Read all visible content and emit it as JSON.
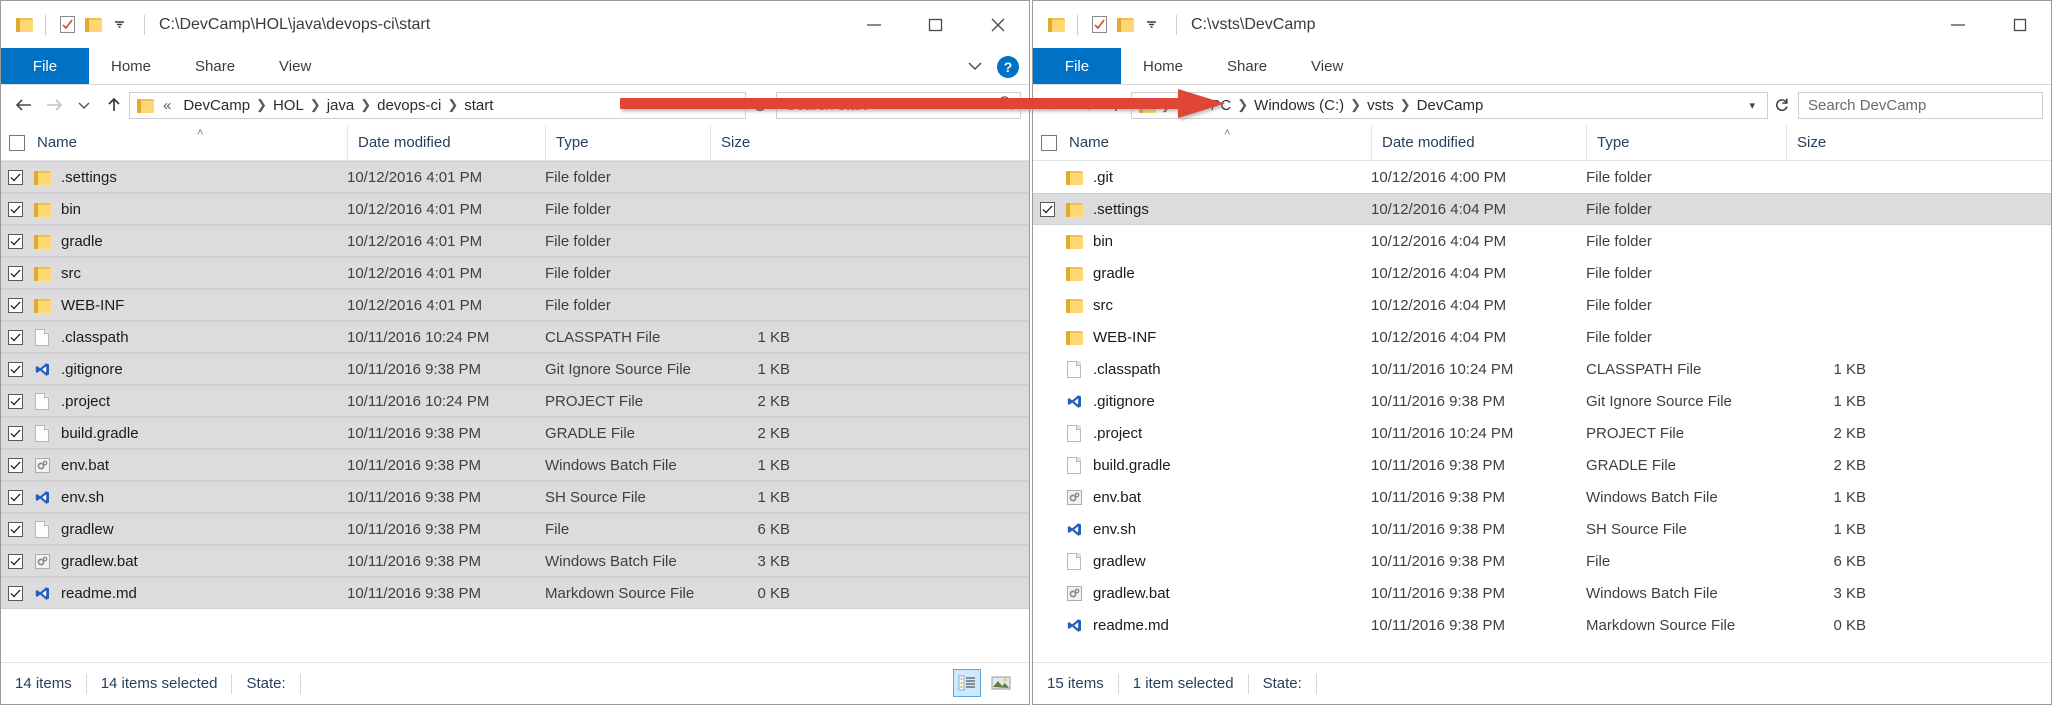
{
  "left_window": {
    "title_path": "C:\\DevCamp\\HOL\\java\\devops-ci\\start",
    "quick_access": {
      "folder_icon": "folder-icon",
      "properties_icon": "properties-icon",
      "new-folder_icon": "new-folder-icon",
      "dropdown_icon": "chevron-down-icon"
    },
    "window_controls": {
      "minimize": "minimize-icon",
      "maximize": "maximize-icon",
      "close": "close-icon"
    },
    "ribbon": {
      "tabs": [
        "File",
        "Home",
        "Share",
        "View"
      ],
      "expand_icon": "chevron-down-icon",
      "help_label": "?"
    },
    "address": {
      "back_icon": "back-arrow-icon",
      "forward_icon": "forward-arrow-icon",
      "recent_icon": "chevron-down-icon",
      "up_icon": "up-arrow-icon",
      "prefix": "«",
      "crumbs": [
        "DevCamp",
        "HOL",
        "java",
        "devops-ci",
        "start"
      ],
      "dropdown_icon": "chevron-down-icon",
      "refresh_icon": "refresh-icon",
      "search_placeholder": "Search start",
      "search_icon": "search-icon"
    },
    "columns": [
      "Name",
      "Date modified",
      "Type",
      "Size"
    ],
    "sort_indicator": "˄",
    "rows": [
      {
        "checked": true,
        "selected": true,
        "icon": "folder-icon",
        "name": ".settings",
        "date": "10/12/2016 4:01 PM",
        "type": "File folder",
        "size": ""
      },
      {
        "checked": true,
        "selected": true,
        "icon": "folder-icon",
        "name": "bin",
        "date": "10/12/2016 4:01 PM",
        "type": "File folder",
        "size": ""
      },
      {
        "checked": true,
        "selected": true,
        "icon": "folder-icon",
        "name": "gradle",
        "date": "10/12/2016 4:01 PM",
        "type": "File folder",
        "size": ""
      },
      {
        "checked": true,
        "selected": true,
        "icon": "folder-icon",
        "name": "src",
        "date": "10/12/2016 4:01 PM",
        "type": "File folder",
        "size": ""
      },
      {
        "checked": true,
        "selected": true,
        "icon": "folder-icon",
        "name": "WEB-INF",
        "date": "10/12/2016 4:01 PM",
        "type": "File folder",
        "size": ""
      },
      {
        "checked": true,
        "selected": true,
        "icon": "document-icon",
        "name": ".classpath",
        "date": "10/11/2016 10:24 PM",
        "type": "CLASSPATH File",
        "size": "1 KB"
      },
      {
        "checked": true,
        "selected": true,
        "icon": "visualstudio-icon",
        "name": ".gitignore",
        "date": "10/11/2016 9:38 PM",
        "type": "Git Ignore Source File",
        "size": "1 KB"
      },
      {
        "checked": true,
        "selected": true,
        "icon": "document-icon",
        "name": ".project",
        "date": "10/11/2016 10:24 PM",
        "type": "PROJECT File",
        "size": "2 KB"
      },
      {
        "checked": true,
        "selected": true,
        "icon": "document-icon",
        "name": "build.gradle",
        "date": "10/11/2016 9:38 PM",
        "type": "GRADLE File",
        "size": "2 KB"
      },
      {
        "checked": true,
        "selected": true,
        "icon": "batch-icon",
        "name": "env.bat",
        "date": "10/11/2016 9:38 PM",
        "type": "Windows Batch File",
        "size": "1 KB"
      },
      {
        "checked": true,
        "selected": true,
        "icon": "visualstudio-icon",
        "name": "env.sh",
        "date": "10/11/2016 9:38 PM",
        "type": "SH Source File",
        "size": "1 KB"
      },
      {
        "checked": true,
        "selected": true,
        "icon": "document-icon",
        "name": "gradlew",
        "date": "10/11/2016 9:38 PM",
        "type": "File",
        "size": "6 KB"
      },
      {
        "checked": true,
        "selected": true,
        "icon": "batch-icon",
        "name": "gradlew.bat",
        "date": "10/11/2016 9:38 PM",
        "type": "Windows Batch File",
        "size": "3 KB"
      },
      {
        "checked": true,
        "selected": true,
        "icon": "visualstudio-icon",
        "name": "readme.md",
        "date": "10/11/2016 9:38 PM",
        "type": "Markdown Source File",
        "size": "0 KB"
      }
    ],
    "status": {
      "count": "14 items",
      "selected": "14 items selected",
      "state_label": "State:",
      "details_view_icon": "details-view-icon",
      "large-icons_view_icon": "large-icons-view-icon"
    }
  },
  "right_window": {
    "title_path": "C:\\vsts\\DevCamp",
    "quick_access": {
      "folder_icon": "folder-icon",
      "properties_icon": "properties-icon",
      "new-folder_icon": "new-folder-icon",
      "dropdown_icon": "chevron-down-icon"
    },
    "window_controls": {
      "minimize": "minimize-icon",
      "maximize": "maximize-icon"
    },
    "ribbon": {
      "tabs": [
        "File",
        "Home",
        "Share",
        "View"
      ]
    },
    "address": {
      "back_icon": "back-arrow-icon",
      "forward_icon": "forward-arrow-icon",
      "up_icon": "up-arrow-icon",
      "crumbs": [
        "This PC",
        "Windows (C:)",
        "vsts",
        "DevCamp"
      ],
      "dropdown_icon": "chevron-down-icon",
      "refresh_icon": "refresh-icon",
      "search_placeholder": "Search DevCamp",
      "search_icon": "search-icon"
    },
    "columns": [
      "Name",
      "Date modified",
      "Type",
      "Size"
    ],
    "sort_indicator": "˄",
    "rows": [
      {
        "checked": false,
        "selected": false,
        "icon": "folder-icon",
        "name": ".git",
        "date": "10/12/2016 4:00 PM",
        "type": "File folder",
        "size": ""
      },
      {
        "checked": true,
        "selected": true,
        "icon": "folder-icon",
        "name": ".settings",
        "date": "10/12/2016 4:04 PM",
        "type": "File folder",
        "size": ""
      },
      {
        "checked": false,
        "selected": false,
        "icon": "folder-icon",
        "name": "bin",
        "date": "10/12/2016 4:04 PM",
        "type": "File folder",
        "size": ""
      },
      {
        "checked": false,
        "selected": false,
        "icon": "folder-icon",
        "name": "gradle",
        "date": "10/12/2016 4:04 PM",
        "type": "File folder",
        "size": ""
      },
      {
        "checked": false,
        "selected": false,
        "icon": "folder-icon",
        "name": "src",
        "date": "10/12/2016 4:04 PM",
        "type": "File folder",
        "size": ""
      },
      {
        "checked": false,
        "selected": false,
        "icon": "folder-icon",
        "name": "WEB-INF",
        "date": "10/12/2016 4:04 PM",
        "type": "File folder",
        "size": ""
      },
      {
        "checked": false,
        "selected": false,
        "icon": "document-icon",
        "name": ".classpath",
        "date": "10/11/2016 10:24 PM",
        "type": "CLASSPATH File",
        "size": "1 KB"
      },
      {
        "checked": false,
        "selected": false,
        "icon": "visualstudio-icon",
        "name": ".gitignore",
        "date": "10/11/2016 9:38 PM",
        "type": "Git Ignore Source File",
        "size": "1 KB"
      },
      {
        "checked": false,
        "selected": false,
        "icon": "document-icon",
        "name": ".project",
        "date": "10/11/2016 10:24 PM",
        "type": "PROJECT File",
        "size": "2 KB"
      },
      {
        "checked": false,
        "selected": false,
        "icon": "document-icon",
        "name": "build.gradle",
        "date": "10/11/2016 9:38 PM",
        "type": "GRADLE File",
        "size": "2 KB"
      },
      {
        "checked": false,
        "selected": false,
        "icon": "batch-icon",
        "name": "env.bat",
        "date": "10/11/2016 9:38 PM",
        "type": "Windows Batch File",
        "size": "1 KB"
      },
      {
        "checked": false,
        "selected": false,
        "icon": "visualstudio-icon",
        "name": "env.sh",
        "date": "10/11/2016 9:38 PM",
        "type": "SH Source File",
        "size": "1 KB"
      },
      {
        "checked": false,
        "selected": false,
        "icon": "document-icon",
        "name": "gradlew",
        "date": "10/11/2016 9:38 PM",
        "type": "File",
        "size": "6 KB"
      },
      {
        "checked": false,
        "selected": false,
        "icon": "batch-icon",
        "name": "gradlew.bat",
        "date": "10/11/2016 9:38 PM",
        "type": "Windows Batch File",
        "size": "3 KB"
      },
      {
        "checked": false,
        "selected": false,
        "icon": "visualstudio-icon",
        "name": "readme.md",
        "date": "10/11/2016 9:38 PM",
        "type": "Markdown Source File",
        "size": "0 KB"
      }
    ],
    "status": {
      "count": "15 items",
      "selected": "1 item selected",
      "state_label": "State:"
    }
  },
  "annotation": {
    "arrow_color": "#e04434",
    "arrow_name": "red-arrow-annotation"
  },
  "colors": {
    "accent_blue": "#0072c6",
    "selection_gray": "#dcdcdc",
    "folder_yellow": "#ffd772",
    "header_text": "#27405e"
  }
}
